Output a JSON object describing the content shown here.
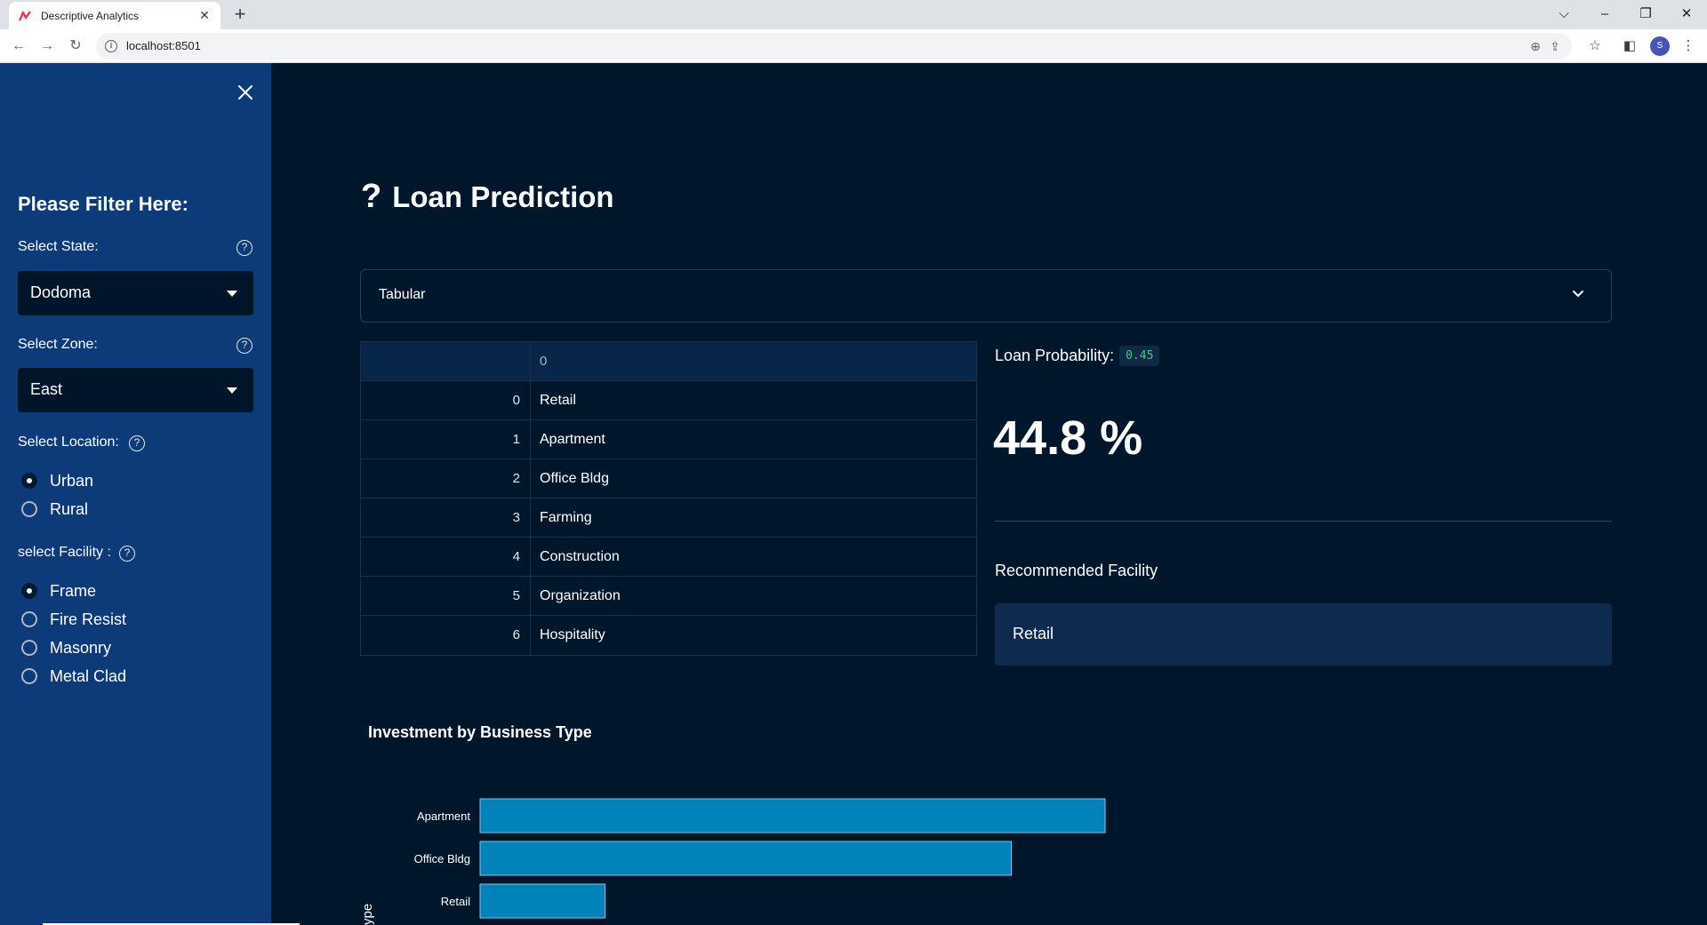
{
  "browser": {
    "tab_title": "Descriptive Analytics",
    "url": "localhost:8501",
    "avatar_initial": "S"
  },
  "sidebar": {
    "title": "Please Filter Here:",
    "state_label": "Select State:",
    "state_value": "Dodoma",
    "zone_label": "Select Zone:",
    "zone_value": "East",
    "location_label": "Select Location:",
    "location_options": [
      "Urban",
      "Rural"
    ],
    "location_selected": "Urban",
    "facility_label": "select Facility :",
    "facility_options": [
      "Frame",
      "Fire Resist",
      "Masonry",
      "Metal Clad"
    ],
    "facility_selected": "Frame",
    "help_glyph": "?"
  },
  "main": {
    "title_icon": "?",
    "title": "Loan Prediction",
    "expander_label": "Tabular",
    "table": {
      "column_header": "0",
      "rows": [
        {
          "index": "0",
          "value": "Retail"
        },
        {
          "index": "1",
          "value": "Apartment"
        },
        {
          "index": "2",
          "value": "Office Bldg"
        },
        {
          "index": "3",
          "value": "Farming"
        },
        {
          "index": "4",
          "value": "Construction"
        },
        {
          "index": "5",
          "value": "Organization"
        },
        {
          "index": "6",
          "value": "Hospitality"
        }
      ]
    },
    "probability_label": "Loan Probability:",
    "probability_code": "0.45",
    "probability_percent": "44.8 %",
    "recommended_label": "Recommended Facility",
    "recommended_value": "Retail"
  },
  "chart_data": {
    "type": "bar",
    "orientation": "horizontal",
    "title": "Investment by Business Type",
    "ylabel_visible_fragment": "ype",
    "categories": [
      "Apartment",
      "Office Bldg",
      "Retail"
    ],
    "values": [
      100,
      85,
      20
    ],
    "xlim": [
      0,
      100
    ],
    "bar_color": "#0083b8"
  },
  "colors": {
    "background": "#00172b",
    "sidebar": "#0d3b7a",
    "accent_bar": "#0083b8",
    "code_green": "#3ccf7a"
  }
}
